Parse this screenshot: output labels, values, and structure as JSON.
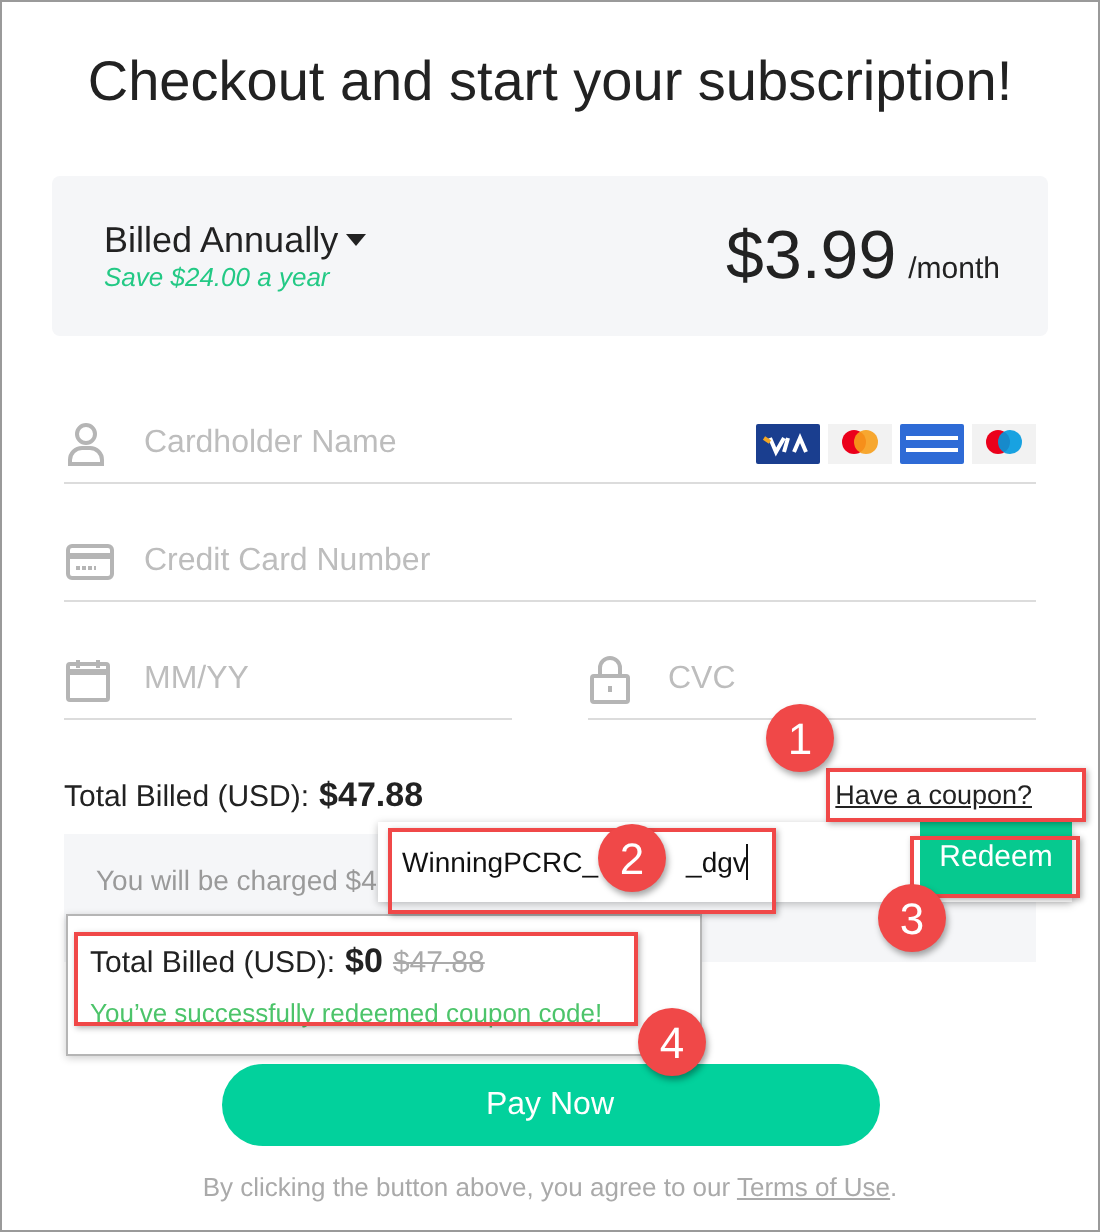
{
  "title": "Checkout and start your subscription!",
  "plan": {
    "billing": "Billed Annually",
    "savings": "Save $24.00 a year",
    "price": "$3.99",
    "period": "/month"
  },
  "fields": [
    {
      "kind": "person",
      "placeholder": "Cardholder Name"
    },
    {
      "kind": "card",
      "placeholder": "Credit Card Number"
    },
    {
      "kind": "calendar",
      "placeholder": "MM/YY"
    },
    {
      "kind": "lock",
      "placeholder": "CVC"
    }
  ],
  "total": {
    "label": "Total Billed (USD):",
    "amount": "$47.88"
  },
  "coupon_link": "Have a coupon?",
  "charge_note": "You will be charged $4",
  "coupon_popup": {
    "value_parts": [
      "WinningPCRC_",
      "_dgv"
    ],
    "button": "Redeem"
  },
  "result_popup": {
    "label": "Total Billed (USD):",
    "amount": "$0",
    "old_amount": "$47.88",
    "message": "You’ve successfully redeemed coupon code!"
  },
  "pay_button": "Pay Now",
  "terms": {
    "text": "By clicking the button above, you agree to our ",
    "link": "Terms of Use",
    "end": "."
  },
  "callouts": [
    {
      "number": "1"
    },
    {
      "number": "2"
    },
    {
      "number": "3"
    },
    {
      "number": "4"
    }
  ]
}
